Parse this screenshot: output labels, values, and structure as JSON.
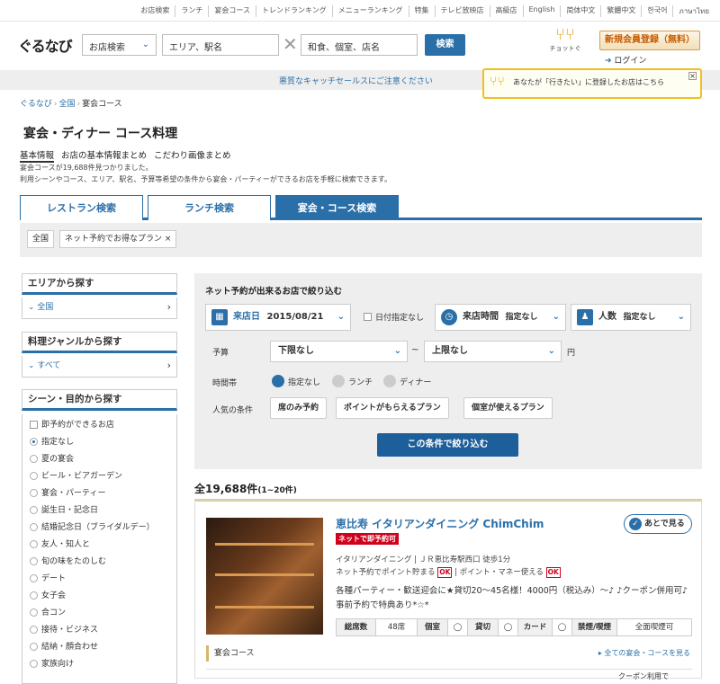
{
  "topnav": [
    "お店検索",
    "ランチ",
    "宴会コース",
    "トレンドランキング",
    "メニューランキング",
    "特集",
    "テレビ放映店",
    "高級店",
    "English",
    "简体中文",
    "繁體中文",
    "한국어",
    "ภาษาไทย"
  ],
  "header": {
    "logo": "ぐるなび",
    "genre_select": "お店検索",
    "area_placeholder": "エリア、駅名",
    "keyword_placeholder": "和食、個室、店名",
    "search_btn": "検索",
    "chotto_label": "チョットぐ",
    "register_btn": "新規会員登録（無料）",
    "login": "ログイン"
  },
  "notice": "悪質なキャッチセールスにご注意ください",
  "popup": "あなたが「行きたい」に登録したお店はこちら",
  "breadcrumb": [
    "ぐるなび",
    "全国",
    "宴会コース"
  ],
  "page_title": "宴会・ディナー コース料理",
  "subnav": [
    "基本情報",
    "お店の基本情報まとめ",
    "こだわり画像まとめ"
  ],
  "desc1": "宴会コースが19,688件見つかりました。",
  "desc2": "利用シーンやコース、エリア、駅名、予算等希望の条件から宴会・パーティーができるお店を手軽に検索できます。",
  "tabs": [
    "レストラン検索",
    "ランチ検索",
    "宴会・コース検索"
  ],
  "chips": [
    "全国",
    "ネット予約でお得なプラン ×"
  ],
  "sidebar": {
    "area_h": "エリアから探す",
    "area_item": "全国",
    "genre_h": "料理ジャンルから探す",
    "genre_item": "すべて",
    "scene_h": "シーン・目的から探す",
    "instant": "即予約ができるお店",
    "scenes": [
      "指定なし",
      "夏の宴会",
      "ビール・ビアガーデン",
      "宴会・パーティー",
      "誕生日・記念日",
      "結婚記念日（ブライダルデー）",
      "友人・知人と",
      "旬の味をたのしむ",
      "デート",
      "女子会",
      "合コン",
      "接待・ビジネス",
      "結納・顔合わせ",
      "家族向け"
    ]
  },
  "filter": {
    "title": "ネット予約が出来るお店で絞り込む",
    "date_label": "来店日",
    "date_value": "2015/08/21",
    "no_date": "日付指定なし",
    "time_label": "来店時間",
    "time_value": "指定なし",
    "people_label": "人数",
    "people_value": "指定なし",
    "budget_label": "予算",
    "budget_min": "下限なし",
    "budget_max": "上限なし",
    "tilde": "~",
    "yen": "円",
    "timeslot_label": "時間帯",
    "timeslots": [
      "指定なし",
      "ランチ",
      "ディナー"
    ],
    "popular_label": "人気の条件",
    "popular": [
      "席のみ予約",
      "ポイントがもらえるプラン",
      "個室が使えるプラン"
    ],
    "apply": "この条件で絞り込む"
  },
  "results": {
    "count": "全19,688件",
    "range": "(1~20件)"
  },
  "card": {
    "name": "恵比寿 イタリアンダイニング ChimChim",
    "net_badge": "ネットで即予約可",
    "later": "あとで見る",
    "genre": "イタリアンダイニング",
    "access": "ＪＲ恵比寿駅西口 徒歩1分",
    "point_text": "ネット予約でポイント貯まる",
    "money_text": "ポイント・マネー使える",
    "ok": "OK",
    "desc": "各種パーティー・歓送迎会に★貸切20〜45名様！4000円（税込み）〜♪ ♪クーポン併用可♪事前予約で特典あり*☆*",
    "table": [
      {
        "h": "総席数",
        "v": "48席"
      },
      {
        "h": "個室",
        "v": "◯"
      },
      {
        "h": "貸切",
        "v": "◯"
      },
      {
        "h": "カード",
        "v": "◯"
      },
      {
        "h": "禁煙/喫煙",
        "v": "全面喫煙可"
      }
    ],
    "course_h": "宴会コース",
    "course_link": "▸ 全ての宴会・コースを見る",
    "coupon": "クーポン利用で"
  }
}
